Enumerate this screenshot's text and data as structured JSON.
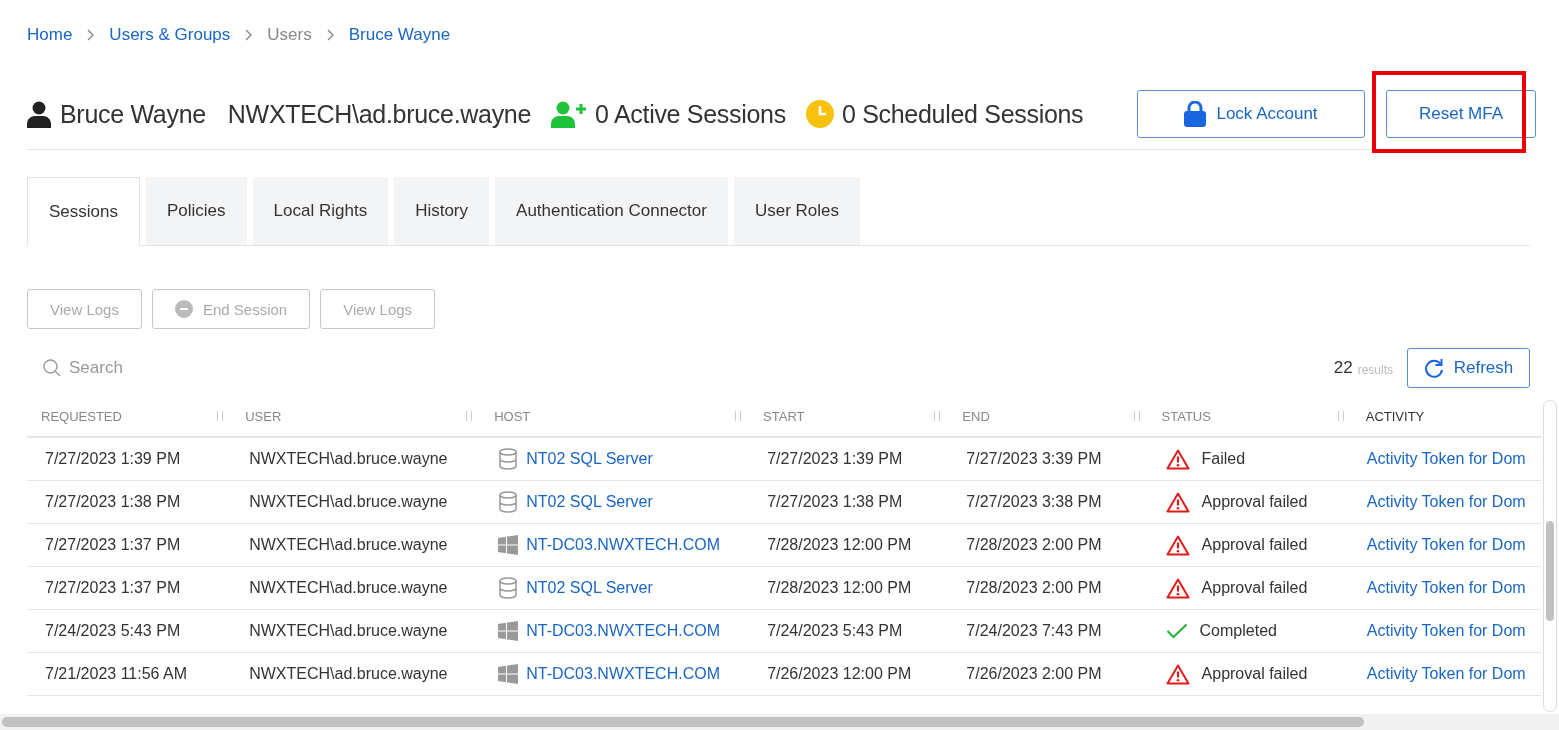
{
  "breadcrumb": [
    {
      "label": "Home",
      "link": true
    },
    {
      "label": "Users & Groups",
      "link": true
    },
    {
      "label": "Users",
      "link": false
    },
    {
      "label": "Bruce Wayne",
      "link": true
    }
  ],
  "header": {
    "name": "Bruce Wayne",
    "account": "NWXTECH\\ad.bruce.wayne",
    "active_sessions": "0 Active Sessions",
    "scheduled_sessions": "0 Scheduled Sessions",
    "lock_button": "Lock Account",
    "reset_button": "Reset MFA",
    "reset_highlighted": true
  },
  "tabs": [
    {
      "label": "Sessions",
      "selected": true
    },
    {
      "label": "Policies",
      "selected": false
    },
    {
      "label": "Local Rights",
      "selected": false
    },
    {
      "label": "History",
      "selected": false
    },
    {
      "label": "Authentication Connector",
      "selected": false
    },
    {
      "label": "User Roles",
      "selected": false
    }
  ],
  "actions": [
    {
      "label": "View Logs",
      "kind": "plain",
      "disabled": true
    },
    {
      "label": "End Session",
      "kind": "end",
      "disabled": true
    },
    {
      "label": "View Logs",
      "kind": "plain",
      "disabled": true
    }
  ],
  "search": {
    "placeholder": "Search"
  },
  "results": {
    "count": "22",
    "label": "results"
  },
  "refresh_button": "Refresh",
  "table": {
    "columns": [
      {
        "label": "REQUESTED",
        "active": false
      },
      {
        "label": "USER",
        "active": false
      },
      {
        "label": "HOST",
        "active": false
      },
      {
        "label": "START",
        "active": false
      },
      {
        "label": "END",
        "active": false
      },
      {
        "label": "STATUS",
        "active": false
      },
      {
        "label": "ACTIVITY",
        "active": true
      }
    ],
    "rows": [
      {
        "requested": "7/27/2023 1:39 PM",
        "user": "NWXTECH\\ad.bruce.wayne",
        "host": {
          "name": "NT02 SQL Server",
          "kind": "database"
        },
        "start": "7/27/2023 1:39 PM",
        "end": "7/27/2023 3:39 PM",
        "status": {
          "label": "Failed",
          "kind": "error"
        },
        "activity": "Activity Token for Dom"
      },
      {
        "requested": "7/27/2023 1:38 PM",
        "user": "NWXTECH\\ad.bruce.wayne",
        "host": {
          "name": "NT02 SQL Server",
          "kind": "database"
        },
        "start": "7/27/2023 1:38 PM",
        "end": "7/27/2023 3:38 PM",
        "status": {
          "label": "Approval failed",
          "kind": "error"
        },
        "activity": "Activity Token for Dom"
      },
      {
        "requested": "7/27/2023 1:37 PM",
        "user": "NWXTECH\\ad.bruce.wayne",
        "host": {
          "name": "NT-DC03.NWXTECH.COM",
          "kind": "windows"
        },
        "start": "7/28/2023 12:00 PM",
        "end": "7/28/2023 2:00 PM",
        "status": {
          "label": "Approval failed",
          "kind": "error"
        },
        "activity": "Activity Token for Dom"
      },
      {
        "requested": "7/27/2023 1:37 PM",
        "user": "NWXTECH\\ad.bruce.wayne",
        "host": {
          "name": "NT02 SQL Server",
          "kind": "database"
        },
        "start": "7/28/2023 12:00 PM",
        "end": "7/28/2023 2:00 PM",
        "status": {
          "label": "Approval failed",
          "kind": "error"
        },
        "activity": "Activity Token for Dom"
      },
      {
        "requested": "7/24/2023 5:43 PM",
        "user": "NWXTECH\\ad.bruce.wayne",
        "host": {
          "name": "NT-DC03.NWXTECH.COM",
          "kind": "windows"
        },
        "start": "7/24/2023 5:43 PM",
        "end": "7/24/2023 7:43 PM",
        "status": {
          "label": "Completed",
          "kind": "success"
        },
        "activity": "Activity Token for Dom"
      },
      {
        "requested": "7/21/2023 11:56 AM",
        "user": "NWXTECH\\ad.bruce.wayne",
        "host": {
          "name": "NT-DC03.NWXTECH.COM",
          "kind": "windows"
        },
        "start": "7/26/2023 12:00 PM",
        "end": "7/26/2023 2:00 PM",
        "status": {
          "label": "Approval failed",
          "kind": "error"
        },
        "activity": "Activity Token for Dom"
      }
    ]
  }
}
